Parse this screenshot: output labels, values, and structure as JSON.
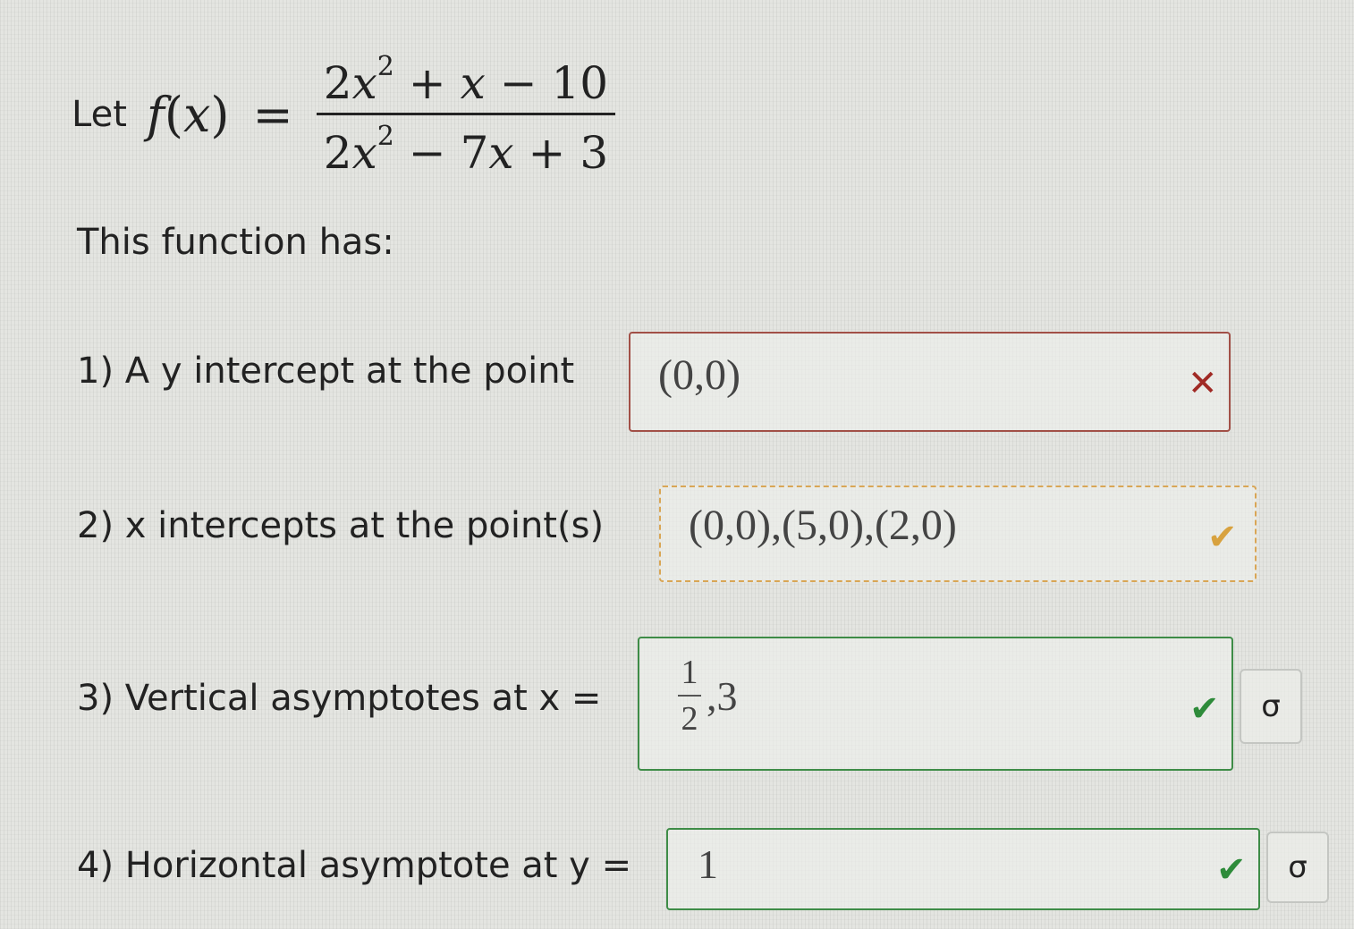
{
  "problem": {
    "let_word": "Let",
    "func_name": "f",
    "func_arg": "x",
    "numerator": {
      "c1": "2",
      "var1": "x",
      "exp1": "2",
      "op1": "+",
      "var2": "x",
      "op2": "−",
      "const": "10"
    },
    "denominator": {
      "c1": "2",
      "var1": "x",
      "exp1": "2",
      "op1": "−",
      "c2": "7",
      "var2": "x",
      "op2": "+",
      "const": "3"
    },
    "intro": "This function has:"
  },
  "questions": [
    {
      "label": "1) A y intercept at the point",
      "answer": "(0,0)",
      "status": "incorrect",
      "status_icon": "✕"
    },
    {
      "label": "2) x intercepts at the point(s)",
      "answer": "(0,0),(5,0),(2,0)",
      "status": "partial",
      "status_icon": "✔"
    },
    {
      "label": "3) Vertical asymptotes at x =",
      "answer_frac_num": "1",
      "answer_frac_den": "2",
      "answer_rest": ",3",
      "status": "correct",
      "status_icon": "✔",
      "tool_icon": "σ"
    },
    {
      "label": "4) Horizontal asymptote at y =",
      "answer": "1",
      "status": "correct",
      "status_icon": "✔",
      "tool_icon": "σ"
    }
  ],
  "colors": {
    "incorrect": "#a02a25",
    "partial": "#d8a23f",
    "correct": "#2e8b3a"
  }
}
